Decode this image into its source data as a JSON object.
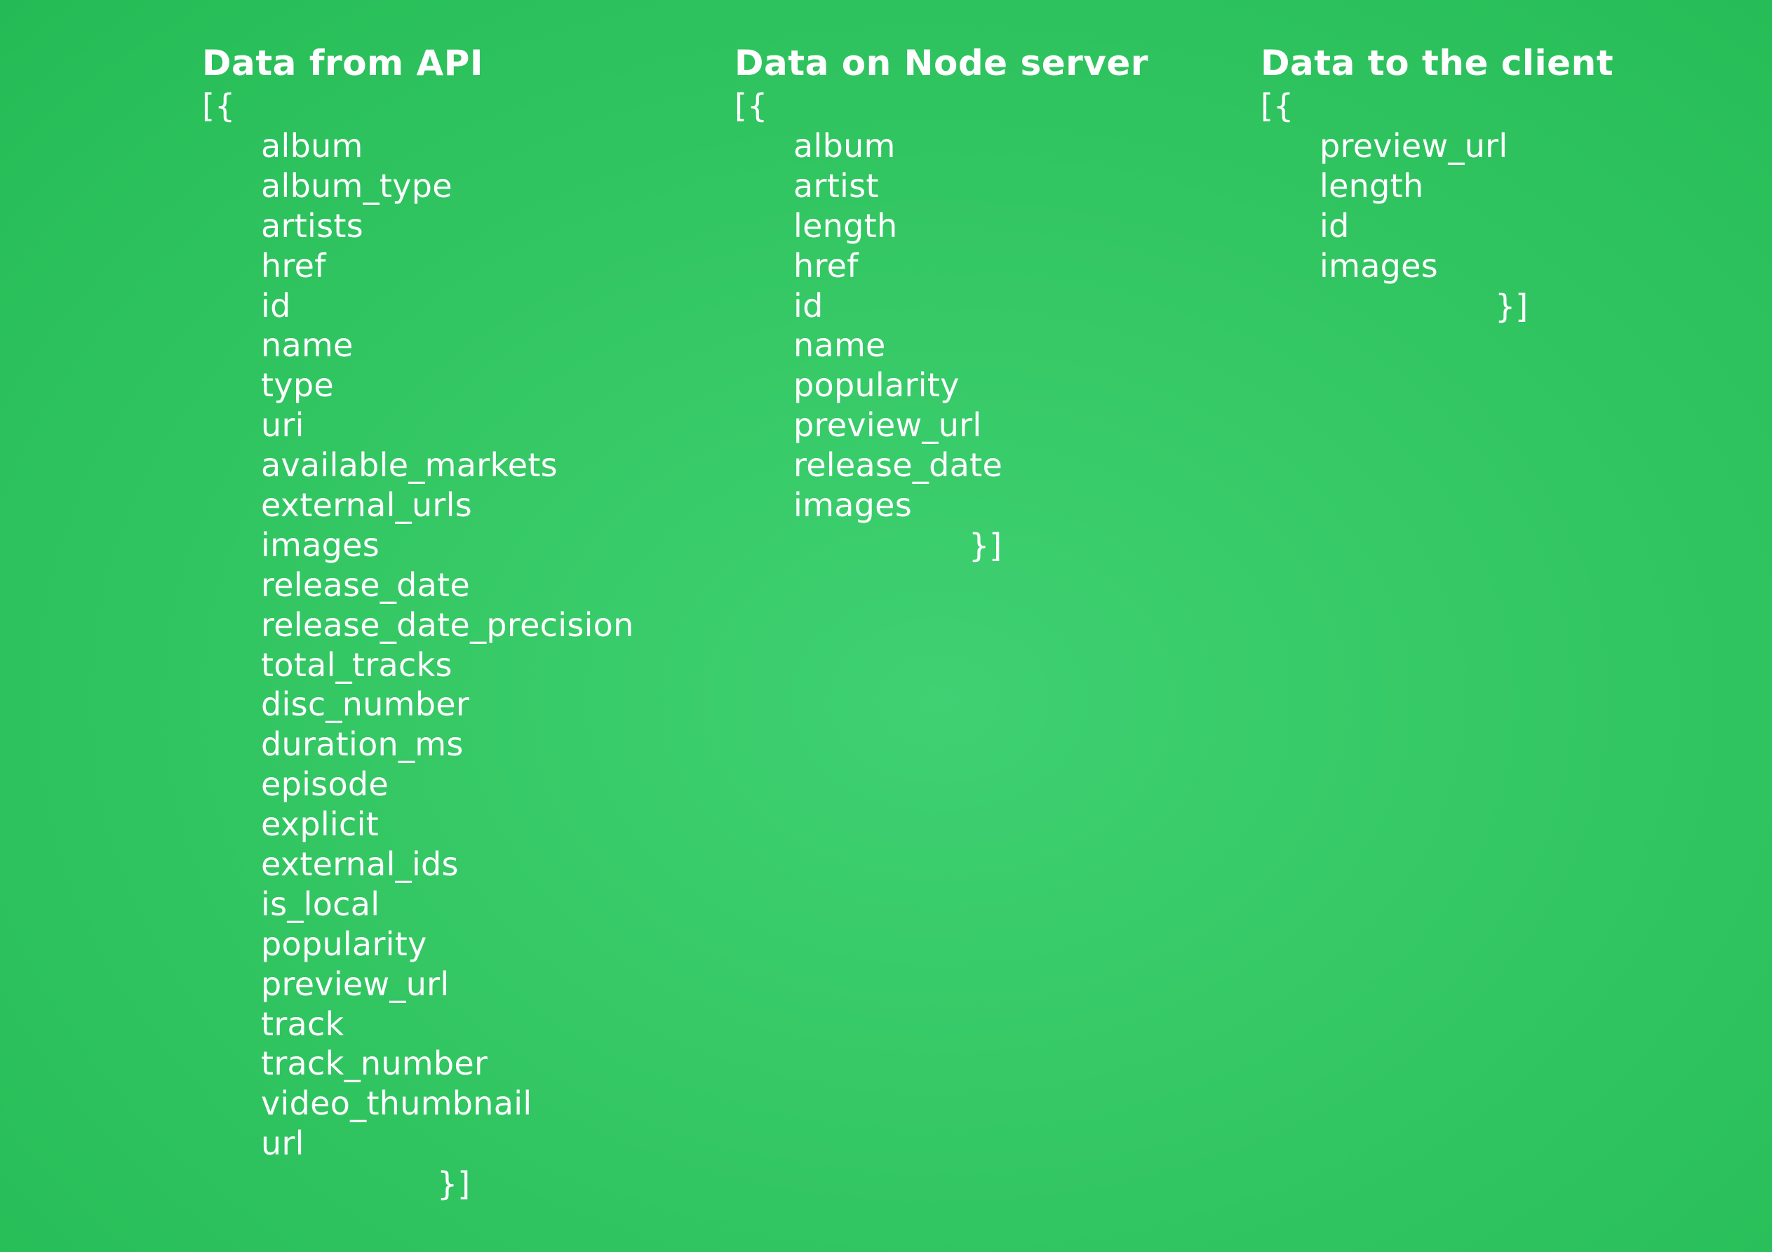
{
  "columns": [
    {
      "title": "Data from API",
      "open": "[{",
      "close": "}]",
      "fields": [
        "album",
        "album_type",
        "artists",
        "href",
        "id",
        "name",
        "type",
        "uri",
        "available_markets",
        "external_urls",
        "images",
        "release_date",
        "release_date_precision",
        "total_tracks",
        "disc_number",
        "duration_ms",
        "episode",
        "explicit",
        "external_ids",
        "is_local",
        "popularity",
        "preview_url",
        "track",
        "track_number",
        "video_thumbnail",
        "url"
      ]
    },
    {
      "title": "Data on Node server",
      "open": "[{",
      "close": "}]",
      "fields": [
        "album",
        "artist",
        "length",
        "href",
        "id",
        "name",
        "popularity",
        "preview_url",
        "release_date",
        "images"
      ]
    },
    {
      "title": "Data to the client",
      "open": "[{",
      "close": "}]",
      "fields": [
        "preview_url",
        "length",
        "id",
        "images"
      ]
    }
  ],
  "colors": {
    "background": "#36c966",
    "text": "#ffffff"
  }
}
